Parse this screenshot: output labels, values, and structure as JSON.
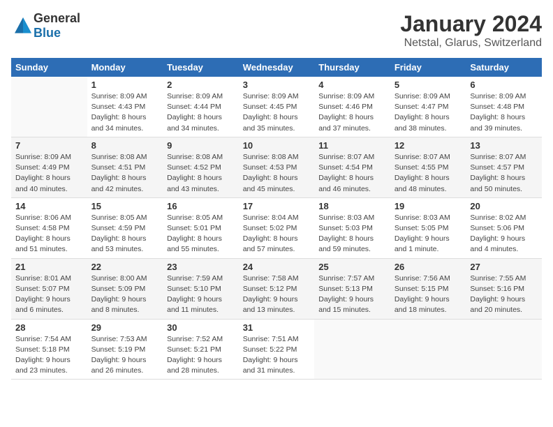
{
  "logo": {
    "text_general": "General",
    "text_blue": "Blue"
  },
  "title": "January 2024",
  "subtitle": "Netstal, Glarus, Switzerland",
  "weekdays": [
    "Sunday",
    "Monday",
    "Tuesday",
    "Wednesday",
    "Thursday",
    "Friday",
    "Saturday"
  ],
  "weeks": [
    [
      {
        "day": "",
        "info": ""
      },
      {
        "day": "1",
        "info": "Sunrise: 8:09 AM\nSunset: 4:43 PM\nDaylight: 8 hours\nand 34 minutes."
      },
      {
        "day": "2",
        "info": "Sunrise: 8:09 AM\nSunset: 4:44 PM\nDaylight: 8 hours\nand 34 minutes."
      },
      {
        "day": "3",
        "info": "Sunrise: 8:09 AM\nSunset: 4:45 PM\nDaylight: 8 hours\nand 35 minutes."
      },
      {
        "day": "4",
        "info": "Sunrise: 8:09 AM\nSunset: 4:46 PM\nDaylight: 8 hours\nand 37 minutes."
      },
      {
        "day": "5",
        "info": "Sunrise: 8:09 AM\nSunset: 4:47 PM\nDaylight: 8 hours\nand 38 minutes."
      },
      {
        "day": "6",
        "info": "Sunrise: 8:09 AM\nSunset: 4:48 PM\nDaylight: 8 hours\nand 39 minutes."
      }
    ],
    [
      {
        "day": "7",
        "info": "Sunrise: 8:09 AM\nSunset: 4:49 PM\nDaylight: 8 hours\nand 40 minutes."
      },
      {
        "day": "8",
        "info": "Sunrise: 8:08 AM\nSunset: 4:51 PM\nDaylight: 8 hours\nand 42 minutes."
      },
      {
        "day": "9",
        "info": "Sunrise: 8:08 AM\nSunset: 4:52 PM\nDaylight: 8 hours\nand 43 minutes."
      },
      {
        "day": "10",
        "info": "Sunrise: 8:08 AM\nSunset: 4:53 PM\nDaylight: 8 hours\nand 45 minutes."
      },
      {
        "day": "11",
        "info": "Sunrise: 8:07 AM\nSunset: 4:54 PM\nDaylight: 8 hours\nand 46 minutes."
      },
      {
        "day": "12",
        "info": "Sunrise: 8:07 AM\nSunset: 4:55 PM\nDaylight: 8 hours\nand 48 minutes."
      },
      {
        "day": "13",
        "info": "Sunrise: 8:07 AM\nSunset: 4:57 PM\nDaylight: 8 hours\nand 50 minutes."
      }
    ],
    [
      {
        "day": "14",
        "info": "Sunrise: 8:06 AM\nSunset: 4:58 PM\nDaylight: 8 hours\nand 51 minutes."
      },
      {
        "day": "15",
        "info": "Sunrise: 8:05 AM\nSunset: 4:59 PM\nDaylight: 8 hours\nand 53 minutes."
      },
      {
        "day": "16",
        "info": "Sunrise: 8:05 AM\nSunset: 5:01 PM\nDaylight: 8 hours\nand 55 minutes."
      },
      {
        "day": "17",
        "info": "Sunrise: 8:04 AM\nSunset: 5:02 PM\nDaylight: 8 hours\nand 57 minutes."
      },
      {
        "day": "18",
        "info": "Sunrise: 8:03 AM\nSunset: 5:03 PM\nDaylight: 8 hours\nand 59 minutes."
      },
      {
        "day": "19",
        "info": "Sunrise: 8:03 AM\nSunset: 5:05 PM\nDaylight: 9 hours\nand 1 minute."
      },
      {
        "day": "20",
        "info": "Sunrise: 8:02 AM\nSunset: 5:06 PM\nDaylight: 9 hours\nand 4 minutes."
      }
    ],
    [
      {
        "day": "21",
        "info": "Sunrise: 8:01 AM\nSunset: 5:07 PM\nDaylight: 9 hours\nand 6 minutes."
      },
      {
        "day": "22",
        "info": "Sunrise: 8:00 AM\nSunset: 5:09 PM\nDaylight: 9 hours\nand 8 minutes."
      },
      {
        "day": "23",
        "info": "Sunrise: 7:59 AM\nSunset: 5:10 PM\nDaylight: 9 hours\nand 11 minutes."
      },
      {
        "day": "24",
        "info": "Sunrise: 7:58 AM\nSunset: 5:12 PM\nDaylight: 9 hours\nand 13 minutes."
      },
      {
        "day": "25",
        "info": "Sunrise: 7:57 AM\nSunset: 5:13 PM\nDaylight: 9 hours\nand 15 minutes."
      },
      {
        "day": "26",
        "info": "Sunrise: 7:56 AM\nSunset: 5:15 PM\nDaylight: 9 hours\nand 18 minutes."
      },
      {
        "day": "27",
        "info": "Sunrise: 7:55 AM\nSunset: 5:16 PM\nDaylight: 9 hours\nand 20 minutes."
      }
    ],
    [
      {
        "day": "28",
        "info": "Sunrise: 7:54 AM\nSunset: 5:18 PM\nDaylight: 9 hours\nand 23 minutes."
      },
      {
        "day": "29",
        "info": "Sunrise: 7:53 AM\nSunset: 5:19 PM\nDaylight: 9 hours\nand 26 minutes."
      },
      {
        "day": "30",
        "info": "Sunrise: 7:52 AM\nSunset: 5:21 PM\nDaylight: 9 hours\nand 28 minutes."
      },
      {
        "day": "31",
        "info": "Sunrise: 7:51 AM\nSunset: 5:22 PM\nDaylight: 9 hours\nand 31 minutes."
      },
      {
        "day": "",
        "info": ""
      },
      {
        "day": "",
        "info": ""
      },
      {
        "day": "",
        "info": ""
      }
    ]
  ]
}
